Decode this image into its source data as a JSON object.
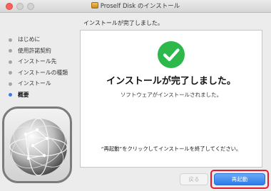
{
  "window": {
    "title": "Proself Disk のインストール",
    "icon": "package-icon"
  },
  "header": {
    "text": "インストールが完了しました。"
  },
  "sidebar": {
    "steps": [
      {
        "label": "はじめに",
        "active": false
      },
      {
        "label": "使用許諾契約",
        "active": false
      },
      {
        "label": "インストール先",
        "active": false
      },
      {
        "label": "インストールの種類",
        "active": false
      },
      {
        "label": "インストール",
        "active": false
      },
      {
        "label": "概要",
        "active": true
      }
    ]
  },
  "content": {
    "status_icon": "check-circle-icon",
    "main_message": "インストールが完了しました。",
    "sub_message": "ソフトウェアがインストールされました。",
    "footer_message": "“再起動”をクリックしてインストールを終了してください。"
  },
  "buttons": {
    "back_label": "戻る",
    "restart_label": "再起動"
  },
  "colors": {
    "accent": "#3b79e5",
    "success": "#2db84c",
    "highlight": "#e8192b"
  }
}
